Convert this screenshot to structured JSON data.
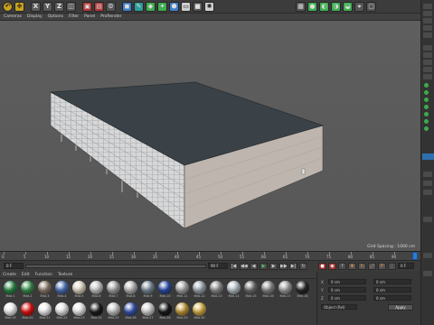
{
  "view_menu": [
    "Cameras",
    "Display",
    "Options",
    "Filter",
    "Panel",
    "ProRender"
  ],
  "viewport": {
    "grid_spacing": "Grid Spacing : 1000 cm"
  },
  "timeline": {
    "ticks": [
      "0",
      "5",
      "10",
      "15",
      "20",
      "25",
      "30",
      "35",
      "40",
      "45",
      "50",
      "55",
      "60",
      "65",
      "70",
      "75",
      "80",
      "85",
      "90"
    ],
    "start_field": "0 F",
    "end_field": "90 F",
    "current_frame": "0 F"
  },
  "material_manager": {
    "menu": [
      "Create",
      "Edit",
      "Function",
      "Texture"
    ],
    "row1": [
      {
        "label": "Mat.1",
        "color": "#2f8a4a"
      },
      {
        "label": "Mat.2",
        "color": "#3c8f4f"
      },
      {
        "label": "Mat.3",
        "color": "#8c7b6b"
      },
      {
        "label": "Mat.4",
        "color": "#4f72b8"
      },
      {
        "label": "Mat.5",
        "color": "#e0d8c6"
      },
      {
        "label": "Mat.6",
        "color": "#c9c9c9"
      },
      {
        "label": "Mat.7",
        "color": "#a5a5a5"
      },
      {
        "label": "Mat.8",
        "color": "#b9b9b9"
      },
      {
        "label": "Mat.9",
        "color": "#7b8c9a"
      },
      {
        "label": "Mat.10",
        "color": "#2c4fa8"
      },
      {
        "label": "Mat.11",
        "color": "#a7a7a7"
      },
      {
        "label": "Mat.12",
        "color": "#9da9b1"
      },
      {
        "label": "Mat.13",
        "color": "#8d8d8d"
      },
      {
        "label": "Mat.14",
        "color": "#b7c3c8"
      },
      {
        "label": "Mat.15",
        "color": "#6f6f6f"
      },
      {
        "label": "Mat.16",
        "color": "#8a8a8a"
      },
      {
        "label": "Mat.17",
        "color": "#a0a0a0"
      },
      {
        "label": "Mat.18",
        "color": "#2a2a2a"
      }
    ],
    "row2": [
      {
        "label": "Mat.19",
        "color": "#f2f2f2"
      },
      {
        "label": "Mat.20",
        "color": "#e01414"
      },
      {
        "label": "Mat.21",
        "color": "#f4f4f4"
      },
      {
        "label": "Mat.22",
        "color": "#e9e9e9"
      },
      {
        "label": "Mat.23",
        "color": "#ececec"
      },
      {
        "label": "Mat.24",
        "color": "#1e1e1e"
      },
      {
        "label": "Mat.25",
        "color": "#c7c7c7"
      },
      {
        "label": "Mat.26",
        "color": "#3a55b0"
      },
      {
        "label": "Mat.27",
        "color": "#d3d3d3"
      },
      {
        "label": "Mat.28",
        "color": "#1b1b1b"
      },
      {
        "label": "Mat.29",
        "color": "#c49a3c"
      },
      {
        "label": "Mat.30",
        "color": "#d8b04a"
      }
    ]
  },
  "attributes": {
    "rows": [
      {
        "a": "0 cm",
        "b": "0 cm"
      },
      {
        "a": "0 cm",
        "b": "0 cm"
      },
      {
        "a": "0 cm",
        "b": "0 cm"
      }
    ],
    "mode": "Object (Rel)",
    "apply_label": "Apply"
  }
}
